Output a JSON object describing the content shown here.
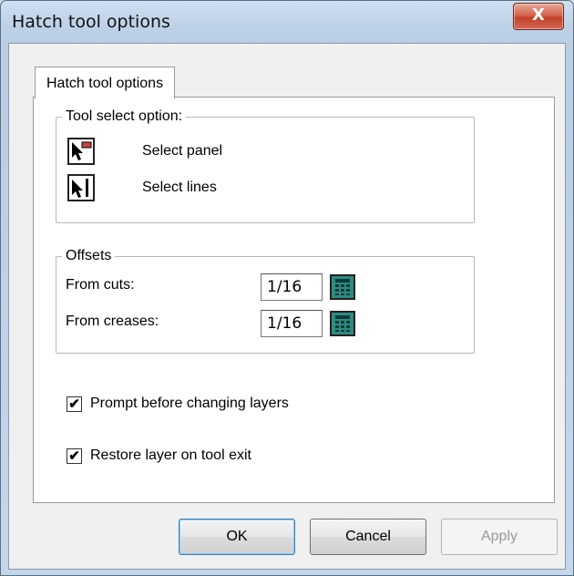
{
  "window": {
    "title": "Hatch tool options",
    "close_glyph": "X"
  },
  "tabs": [
    {
      "label": "Hatch tool options",
      "selected": true
    }
  ],
  "tool_select": {
    "legend": "Tool select option:",
    "options": [
      {
        "label": "Select panel",
        "icon": "select-panel-icon"
      },
      {
        "label": "Select lines",
        "icon": "select-lines-icon"
      }
    ]
  },
  "offsets": {
    "legend": "Offsets",
    "fields": [
      {
        "label": "From cuts:",
        "value": "1/16"
      },
      {
        "label": "From creases:",
        "value": "1/16"
      }
    ]
  },
  "checkboxes": [
    {
      "label": "Prompt before changing layers",
      "checked": true,
      "mark": "✔"
    },
    {
      "label": "Restore layer on tool exit",
      "checked": true,
      "mark": "✔"
    }
  ],
  "buttons": {
    "ok": "OK",
    "cancel": "Cancel",
    "apply": "Apply"
  },
  "colors": {
    "calculator_icon": "#2e8b82",
    "close_button": "#c2402a",
    "accent_red": "#c8463c"
  }
}
